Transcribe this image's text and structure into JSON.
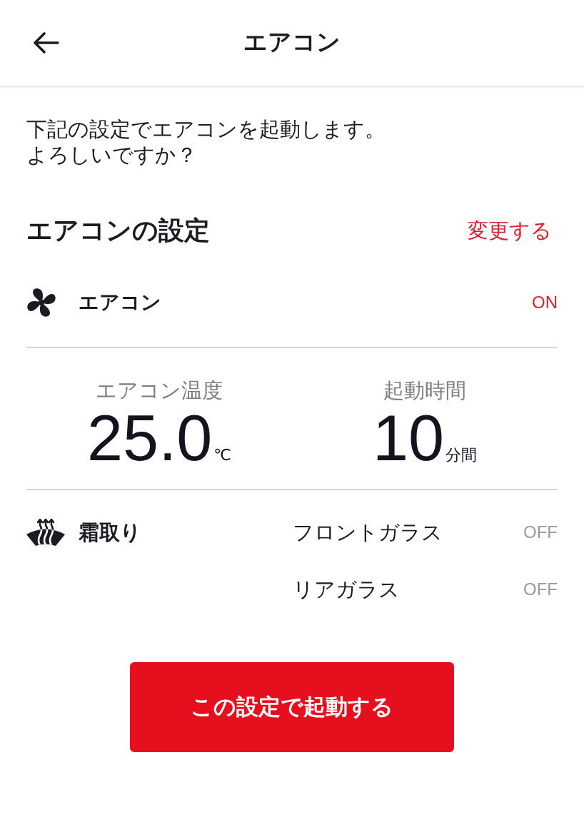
{
  "header": {
    "title": "エアコン"
  },
  "intro": [
    "下記の設定でエアコンを起動します。",
    "よろしいですか？"
  ],
  "settings": {
    "title": "エアコンの設定",
    "change_link": "変更する",
    "air_conditioner": {
      "label": "エアコン",
      "status": "ON",
      "on": true
    },
    "stats": [
      {
        "label": "エアコン温度",
        "value": "25.0",
        "unit": "℃"
      },
      {
        "label": "起動時間",
        "value": "10",
        "unit": "分間"
      }
    ],
    "defrost": {
      "label": "霜取り",
      "items": [
        {
          "label": "フロントガラス",
          "status": "OFF",
          "on": false
        },
        {
          "label": "リアガラス",
          "status": "OFF",
          "on": false
        }
      ]
    }
  },
  "start_button": "この設定で起動する"
}
